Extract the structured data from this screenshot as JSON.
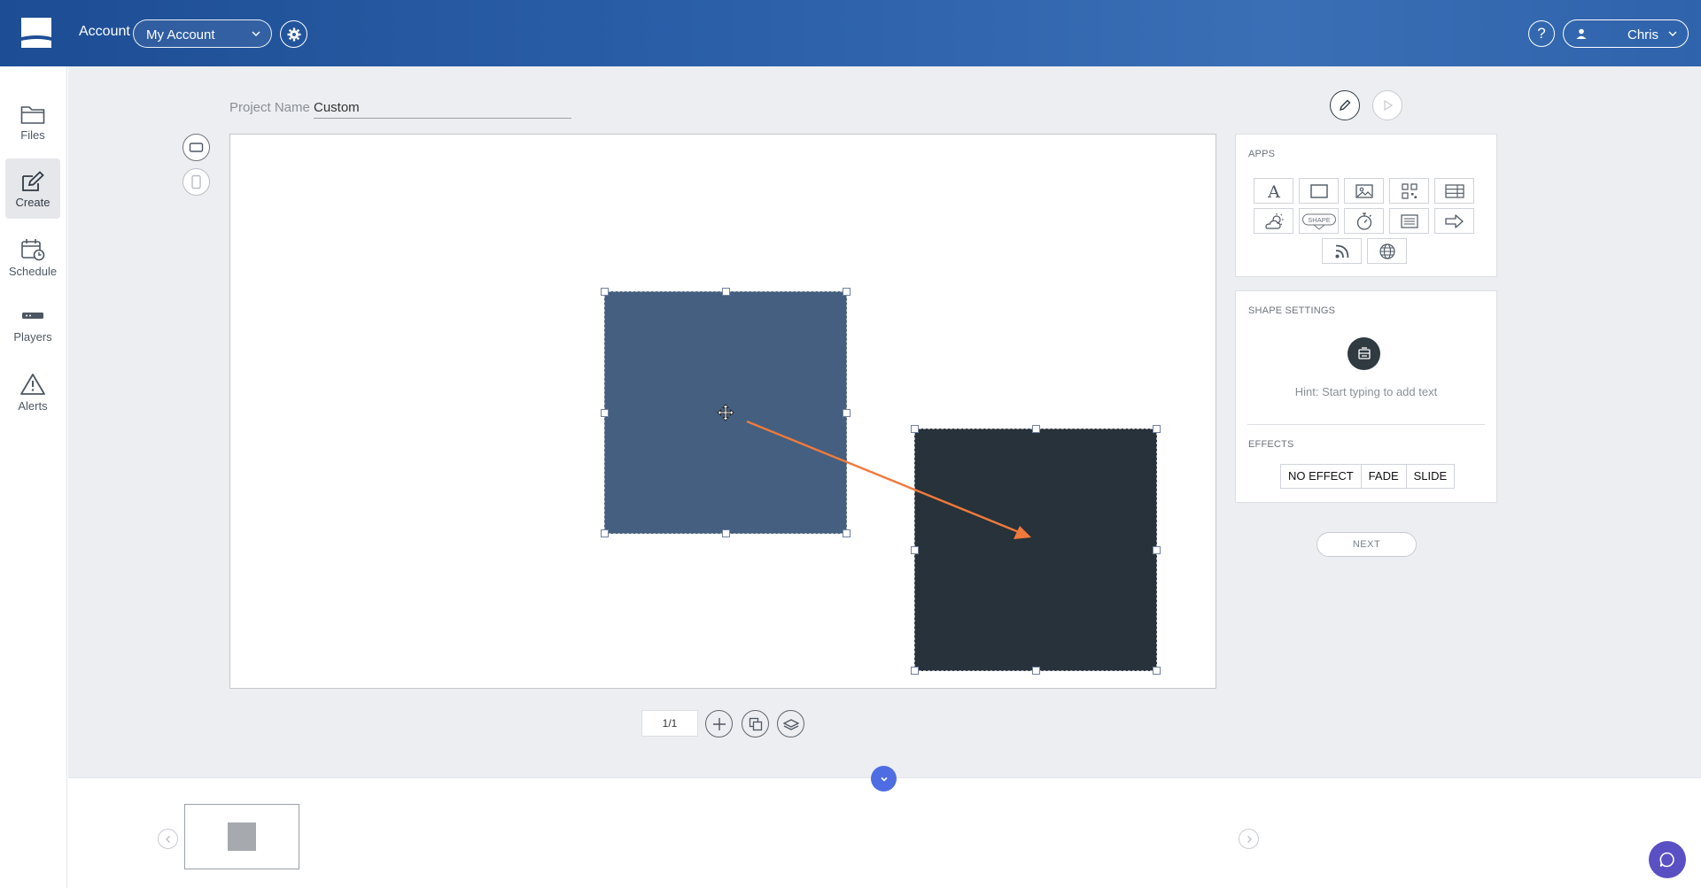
{
  "header": {
    "account_label": "Account",
    "account_selected": "My Account",
    "help_label": "?",
    "user_name": "Chris"
  },
  "sidebar": {
    "items": [
      {
        "label": "Files",
        "icon": "folder-icon"
      },
      {
        "label": "Create",
        "icon": "create-icon",
        "active": true
      },
      {
        "label": "Schedule",
        "icon": "calendar-clock-icon"
      },
      {
        "label": "Players",
        "icon": "player-device-icon"
      },
      {
        "label": "Alerts",
        "icon": "alert-triangle-icon"
      }
    ]
  },
  "project": {
    "name_label": "Project Name",
    "name_value": "Custom"
  },
  "pager": {
    "text": "1/1"
  },
  "apps_panel": {
    "title": "APPS",
    "apps": [
      "text-app-icon",
      "rectangle-app-icon",
      "image-app-icon",
      "qr-code-app-icon",
      "table-app-icon",
      "weather-app-icon",
      "shape-app-icon",
      "timer-app-icon",
      "list-app-icon",
      "arrow-app-icon",
      "rss-app-icon",
      "web-app-icon"
    ],
    "shape_app_text": "SHAPE"
  },
  "shape_settings": {
    "title": "SHAPE SETTINGS",
    "hint": "Hint: Start typing to add text",
    "effects_title": "EFFECTS",
    "effects": [
      "NO EFFECT",
      "FADE",
      "SLIDE"
    ]
  },
  "next_label": "NEXT",
  "colors": {
    "header_blue": "#2a5fa8",
    "shape_1": "#445f80",
    "shape_2": "#27323a",
    "arrow": "#f07a3c",
    "accent": "#4e6de2",
    "chat": "#5b4fc4"
  }
}
